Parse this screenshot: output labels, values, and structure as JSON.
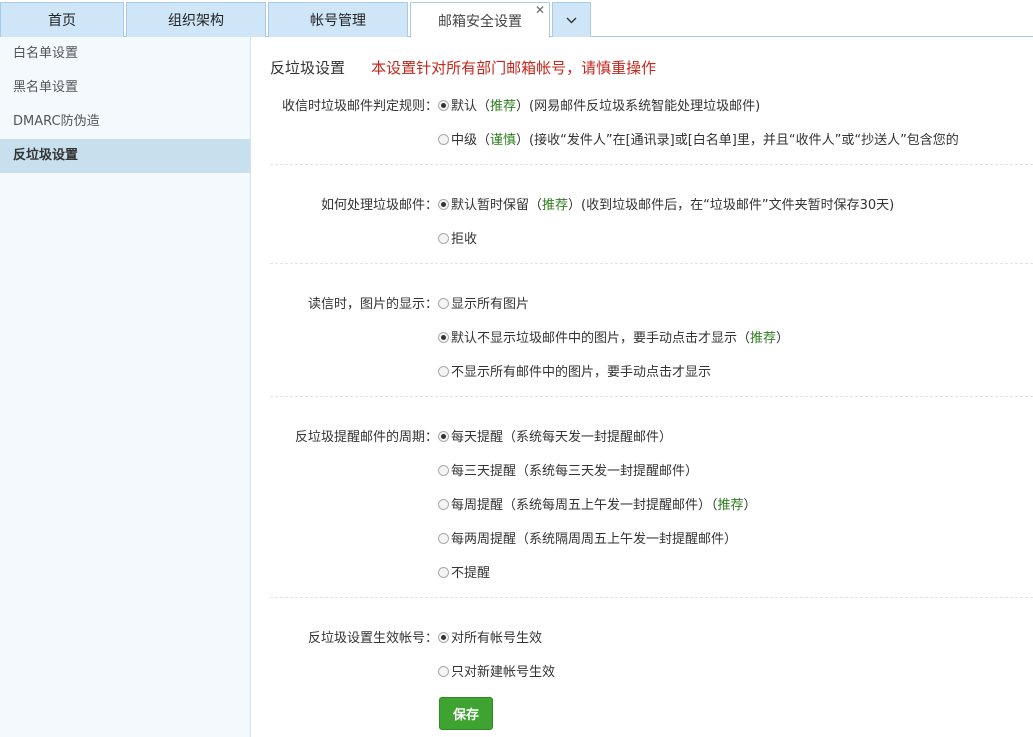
{
  "tabs": [
    {
      "label": "首页"
    },
    {
      "label": "组织架构"
    },
    {
      "label": "帐号管理"
    },
    {
      "label": "邮箱安全设置"
    }
  ],
  "sidebar": {
    "items": [
      {
        "label": "白名单设置"
      },
      {
        "label": "黑名单设置"
      },
      {
        "label": "DMARC防伪造"
      },
      {
        "label": "反垃圾设置"
      }
    ]
  },
  "header": {
    "title": "反垃圾设置",
    "warning": "本设置针对所有部门邮箱帐号，请慎重操作"
  },
  "sections": [
    {
      "label": "收信时垃圾邮件判定规则：",
      "options": [
        {
          "pre": "默认（",
          "tag": "推荐",
          "post": "）(网易邮件反垃圾系统智能处理垃圾邮件)",
          "checked": true
        },
        {
          "pre": "中级（",
          "tag": "谨慎",
          "post": "）(接收“发件人”在[通讯录]或[白名单]里，并且“收件人”或“抄送人”包含您的",
          "checked": false
        }
      ]
    },
    {
      "label": "如何处理垃圾邮件：",
      "options": [
        {
          "pre": "默认暂时保留（",
          "tag": "推荐",
          "post": "）(收到垃圾邮件后，在“垃圾邮件”文件夹暂时保存30天)",
          "checked": true
        },
        {
          "pre": "拒收",
          "tag": "",
          "post": "",
          "checked": false
        }
      ]
    },
    {
      "label": "读信时，图片的显示：",
      "options": [
        {
          "pre": "显示所有图片",
          "tag": "",
          "post": "",
          "checked": false
        },
        {
          "pre": "默认不显示垃圾邮件中的图片，要手动点击才显示（",
          "tag": "推荐",
          "post": "）",
          "checked": true
        },
        {
          "pre": "不显示所有邮件中的图片，要手动点击才显示",
          "tag": "",
          "post": "",
          "checked": false
        }
      ]
    },
    {
      "label": "反垃圾提醒邮件的周期：",
      "options": [
        {
          "pre": "每天提醒（系统每天发一封提醒邮件）",
          "tag": "",
          "post": "",
          "checked": true
        },
        {
          "pre": "每三天提醒（系统每三天发一封提醒邮件）",
          "tag": "",
          "post": "",
          "checked": false
        },
        {
          "pre": "每周提醒（系统每周五上午发一封提醒邮件）（",
          "tag": "推荐",
          "post": "）",
          "checked": false
        },
        {
          "pre": "每两周提醒（系统隔周周五上午发一封提醒邮件）",
          "tag": "",
          "post": "",
          "checked": false
        },
        {
          "pre": "不提醒",
          "tag": "",
          "post": "",
          "checked": false
        }
      ]
    },
    {
      "label": "反垃圾设置生效帐号：",
      "options": [
        {
          "pre": "对所有帐号生效",
          "tag": "",
          "post": "",
          "checked": true
        },
        {
          "pre": "只对新建帐号生效",
          "tag": "",
          "post": "",
          "checked": false
        }
      ]
    }
  ],
  "save_label": "保存"
}
